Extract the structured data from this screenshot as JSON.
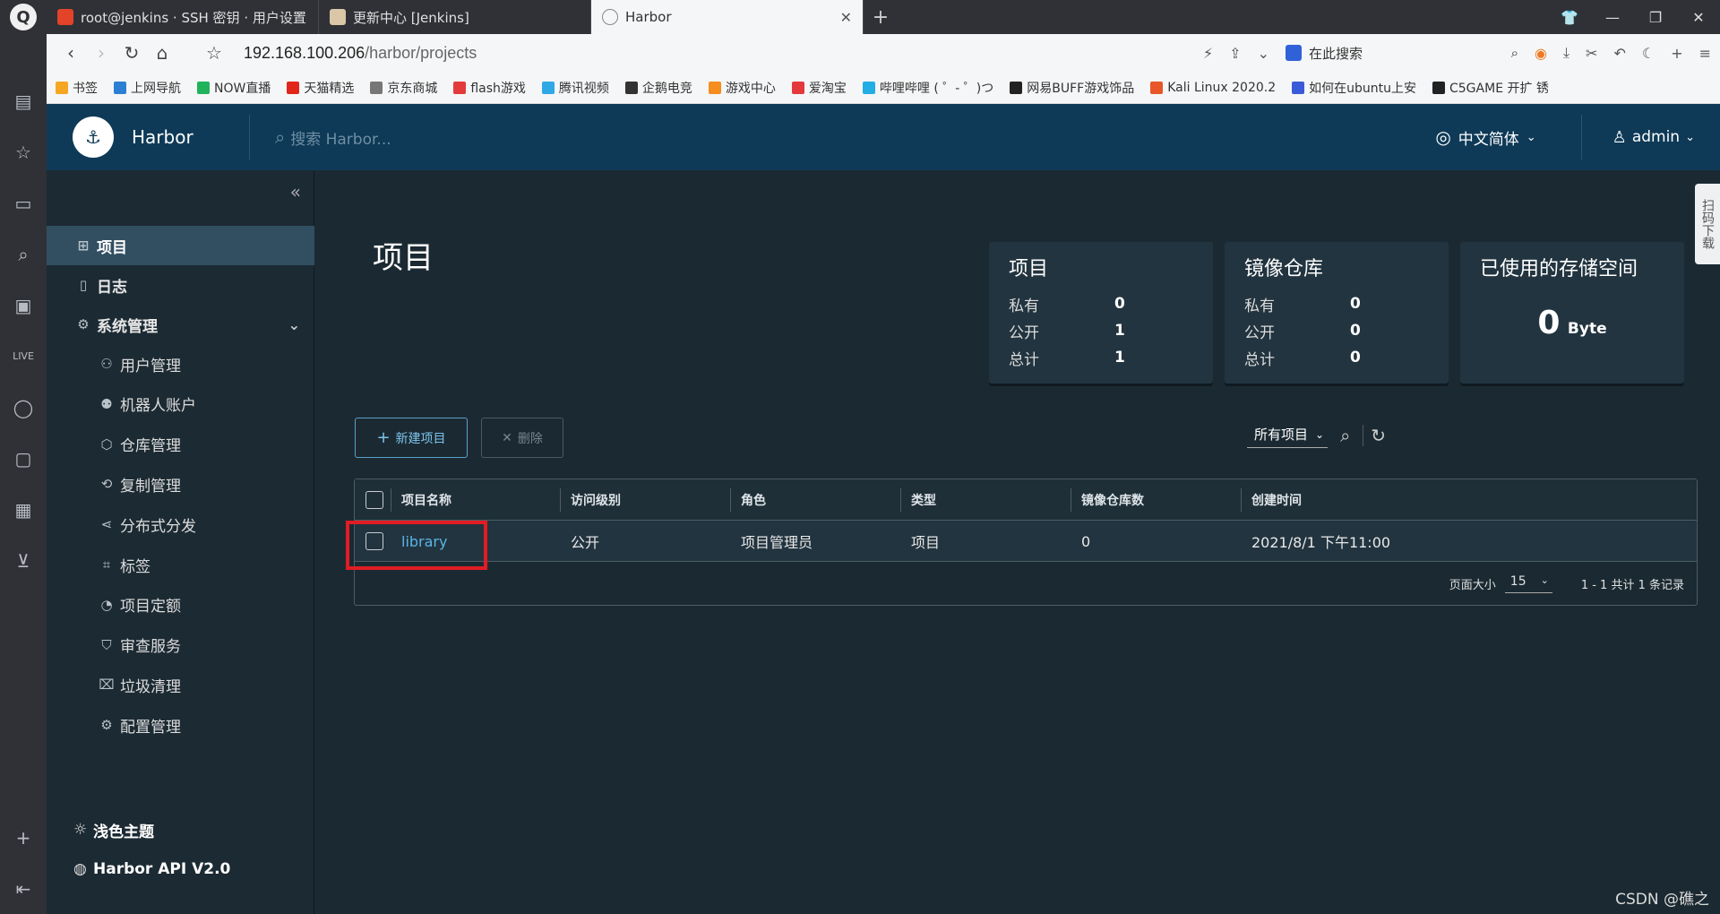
{
  "browser": {
    "logo": "Q",
    "tabs": [
      {
        "title": "root@jenkins · SSH 密钥 · 用户设置",
        "favicon_color": "#e24329"
      },
      {
        "title": "更新中心 [Jenkins]",
        "favicon_color": "#d24939"
      },
      {
        "title": "Harbor",
        "favicon_color": "#888888"
      }
    ],
    "new_tab": "+",
    "url_host": "192.168.100.206",
    "url_path": "/harbor/projects",
    "search_engine_label": "在此搜索",
    "bookmarks": [
      {
        "label": "书签",
        "color": "#f5a623"
      },
      {
        "label": "上网导航",
        "color": "#2d7fd3"
      },
      {
        "label": "NOW直播",
        "color": "#20b35a"
      },
      {
        "label": "天猫精选",
        "color": "#e1251b"
      },
      {
        "label": "京东商城",
        "color": "#777777"
      },
      {
        "label": "flash游戏",
        "color": "#e33b3b"
      },
      {
        "label": "腾讯视频",
        "color": "#2fa8e6"
      },
      {
        "label": "企鹅电竞",
        "color": "#333333"
      },
      {
        "label": "游戏中心",
        "color": "#f58d1f"
      },
      {
        "label": "爱淘宝",
        "color": "#e4393c"
      },
      {
        "label": "哔哩哔哩 ( ゜- ゜)つ",
        "color": "#23ade5"
      },
      {
        "label": "网易BUFF游戏饰品",
        "color": "#222222"
      },
      {
        "label": "Kali Linux 2020.2",
        "color": "#e8562a"
      },
      {
        "label": "如何在ubuntu上安",
        "color": "#3a5bd9"
      },
      {
        "label": "C5GAME 开扩 锈",
        "color": "#222222"
      }
    ]
  },
  "header": {
    "app_name": "Harbor",
    "search_placeholder": "搜索 Harbor...",
    "language": "中文简体",
    "user": "admin"
  },
  "nav": {
    "items": [
      {
        "label": "项目",
        "icon": "project-icon"
      },
      {
        "label": "日志",
        "icon": "log-icon"
      },
      {
        "label": "系统管理",
        "icon": "system-admin-icon"
      }
    ],
    "sub_items": [
      {
        "label": "用户管理",
        "icon": "users-icon"
      },
      {
        "label": "机器人账户",
        "icon": "robot-icon"
      },
      {
        "label": "仓库管理",
        "icon": "registry-icon"
      },
      {
        "label": "复制管理",
        "icon": "replication-icon"
      },
      {
        "label": "分布式分发",
        "icon": "distribution-icon"
      },
      {
        "label": "标签",
        "icon": "tag-icon"
      },
      {
        "label": "项目定额",
        "icon": "quota-icon"
      },
      {
        "label": "审查服务",
        "icon": "shield-icon"
      },
      {
        "label": "垃圾清理",
        "icon": "trash-icon"
      },
      {
        "label": "配置管理",
        "icon": "gear-icon"
      }
    ],
    "theme": "浅色主题",
    "api": "Harbor API V2.0"
  },
  "main": {
    "title": "项目",
    "cards": [
      {
        "title": "项目",
        "rows": [
          {
            "k": "私有",
            "v": "0"
          },
          {
            "k": "公开",
            "v": "1"
          },
          {
            "k": "总计",
            "v": "1"
          }
        ]
      },
      {
        "title": "镜像仓库",
        "rows": [
          {
            "k": "私有",
            "v": "0"
          },
          {
            "k": "公开",
            "v": "0"
          },
          {
            "k": "总计",
            "v": "0"
          }
        ]
      }
    ],
    "storage": {
      "title": "已使用的存储空间",
      "value": "0",
      "unit": "Byte"
    },
    "new_project": "新建项目",
    "delete": "删除",
    "filter": "所有项目",
    "columns": [
      "项目名称",
      "访问级别",
      "角色",
      "类型",
      "镜像仓库数",
      "创建时间"
    ],
    "rows": [
      {
        "name": "library",
        "access": "公开",
        "role": "项目管理员",
        "type": "项目",
        "repos": "0",
        "created": "2021/8/1 下午11:00"
      }
    ],
    "page_size_label": "页面大小",
    "page_size": "15",
    "pagination": "1 - 1 共计 1 条记录"
  },
  "side_tab": "扫码下载",
  "watermark": "CSDN @礁之"
}
